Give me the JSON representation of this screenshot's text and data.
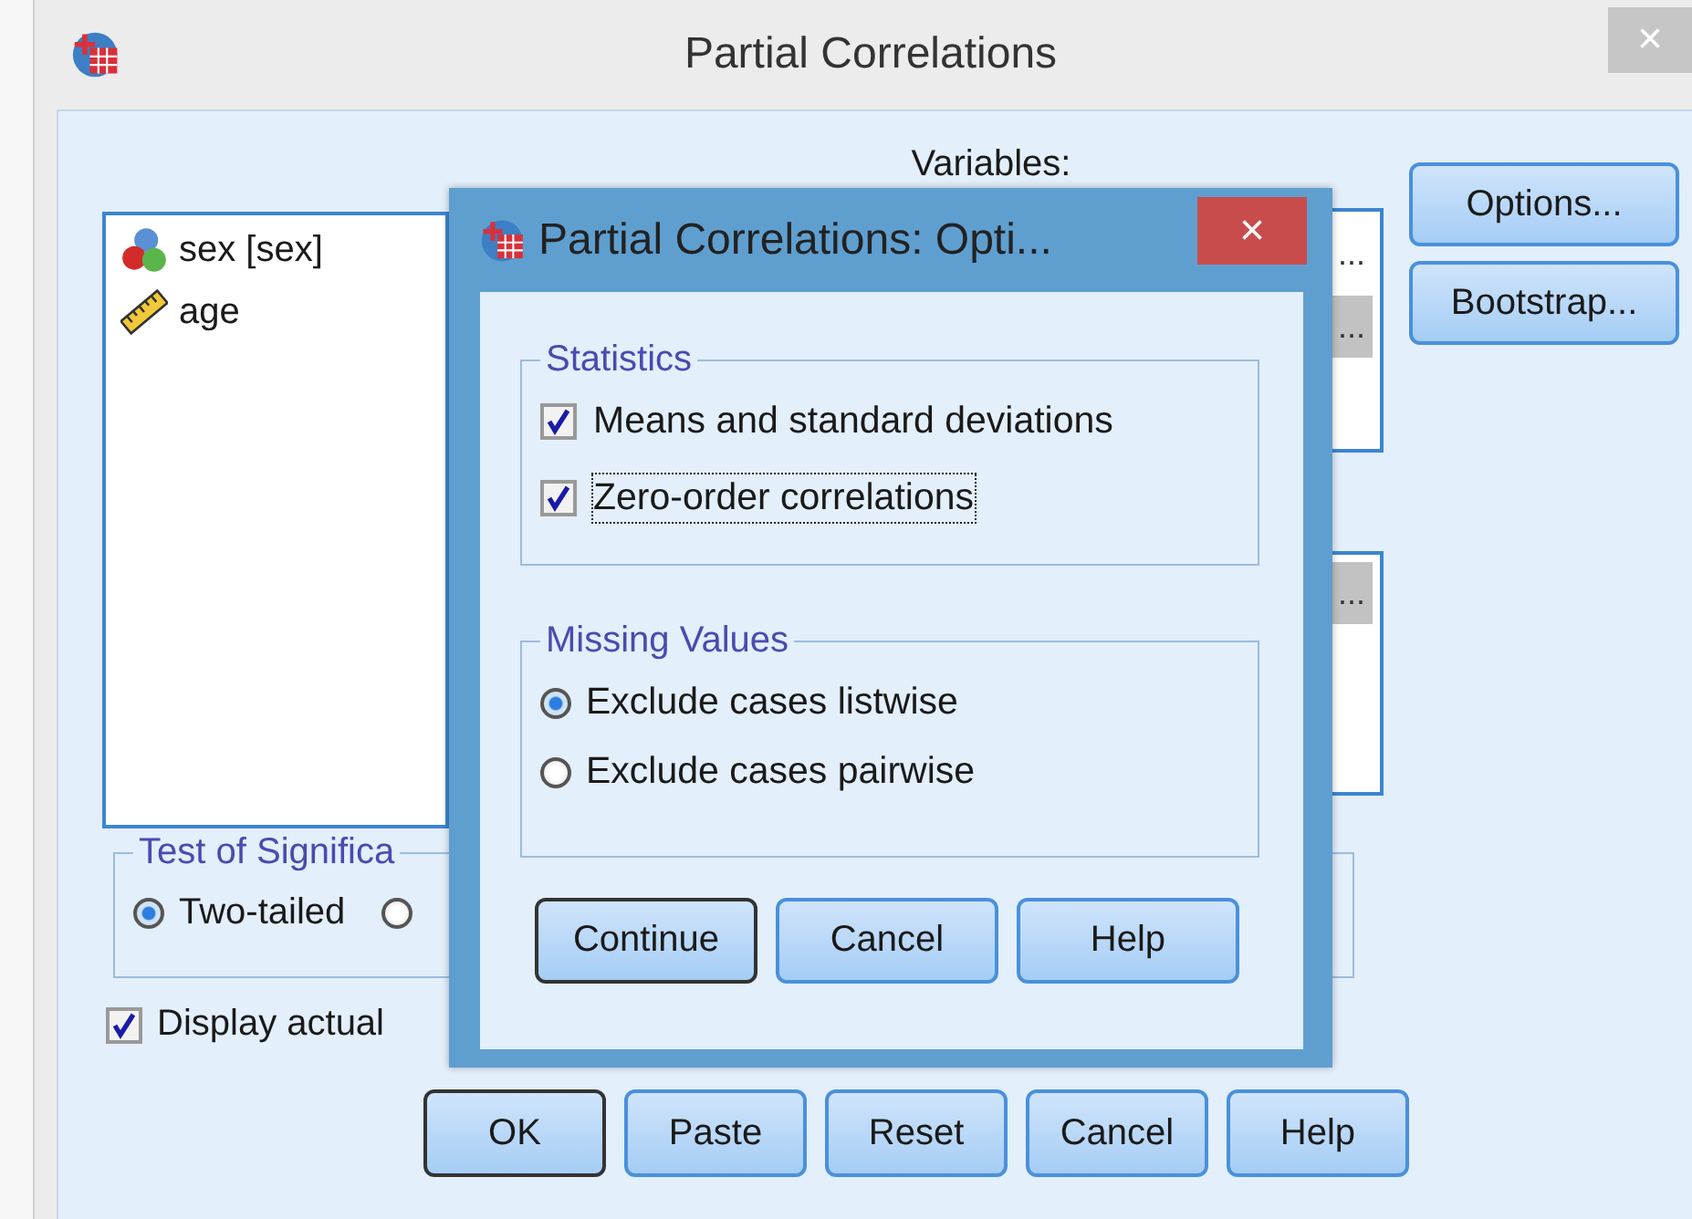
{
  "main_window": {
    "title": "Partial Correlations",
    "close_glyph": "×"
  },
  "source_list": [
    {
      "name": "sex [sex]",
      "kind": "nominal"
    },
    {
      "name": "age",
      "kind": "scale"
    }
  ],
  "variables": {
    "label": "Variables:",
    "items": [
      {
        "text": "...",
        "selected": false
      },
      {
        "text": "...",
        "selected": true
      }
    ]
  },
  "controlling": {
    "items": [
      {
        "text": "...",
        "selected": true
      }
    ]
  },
  "side_buttons": [
    "Options...",
    "Bootstrap..."
  ],
  "significance": {
    "title": "Test of Significa",
    "options": [
      {
        "label": "Two-tailed",
        "selected": true
      },
      {
        "selected": false
      }
    ]
  },
  "display_actual": {
    "label": "Display actual",
    "checked": true
  },
  "bottom_buttons": [
    {
      "label": "OK",
      "default": true
    },
    {
      "label": "Paste",
      "default": false
    },
    {
      "label": "Reset",
      "default": false
    },
    {
      "label": "Cancel",
      "default": false
    },
    {
      "label": "Help",
      "default": false
    }
  ],
  "options_dialog": {
    "title": "Partial Correlations: Opti...",
    "close_glyph": "×",
    "statistics": {
      "title": "Statistics",
      "options": [
        {
          "label": "Means and standard deviations",
          "checked": true,
          "focused": false
        },
        {
          "label": "Zero-order correlations",
          "checked": true,
          "focused": true
        }
      ]
    },
    "missing": {
      "title": "Missing Values",
      "options": [
        {
          "label": "Exclude cases listwise",
          "selected": true
        },
        {
          "label": "Exclude cases pairwise",
          "selected": false
        }
      ]
    },
    "buttons": [
      {
        "label": "Continue",
        "default": true
      },
      {
        "label": "Cancel",
        "default": false
      },
      {
        "label": "Help",
        "default": false
      }
    ]
  }
}
